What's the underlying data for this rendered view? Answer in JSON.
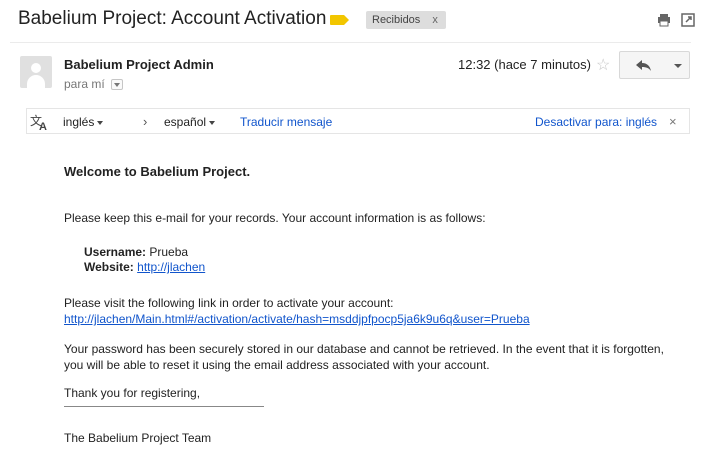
{
  "email": {
    "subject": "Babelium Project: Account Activation",
    "label_color": "#f2c600",
    "inbox_tag": "Recibidos",
    "inbox_tag_close": "x",
    "sender": "Babelium Project Admin",
    "recipient": "para mí",
    "timestamp": "12:32 (hace 7 minutos)"
  },
  "icons": {
    "print": "print-icon",
    "popout": "open-in-new-window-icon",
    "star": "star-icon",
    "reply": "reply-icon",
    "more": "chevron-down-icon",
    "translate": "translate-icon"
  },
  "translate": {
    "source_lang": "inglés",
    "arrow": "›",
    "target_lang": "español",
    "translate_link": "Traducir mensaje",
    "disable_link": "Desactivar para: inglés",
    "close": "×"
  },
  "message": {
    "welcome": "Welcome to Babelium Project.",
    "intro": "Please keep this e-mail for your records. Your account information is as follows:",
    "username_label": "Username:",
    "username_value": "Prueba",
    "website_label": "Website:",
    "website_value": "http://jlachen",
    "activate_text": "Please visit the following link in order to activate your account:",
    "activate_link": "http://jlachen/Main.html#/activation/activate/hash=msddjpfpocp5ja6k9u6q&user=Prueba",
    "password_text": "Your password has been securely stored in our database and cannot be retrieved. In the event that it is forgotten, you will be able to reset it using the email address associated with your account.",
    "thanks": "Thank you for registering,",
    "team": "The Babelium Project Team"
  },
  "colors": {
    "link": "#1155cc",
    "label": "#f2c600"
  }
}
